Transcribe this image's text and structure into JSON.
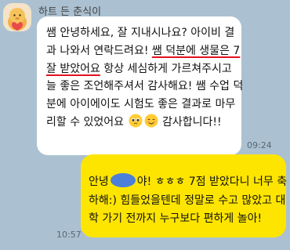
{
  "chat": {
    "sender_name": "하트 든 춘식이",
    "incoming": {
      "lines": [
        "쌤 안녕하세요, 잘 지내시나요? 아이비 결",
        "과 나와서 연락드려요! ",
        "잘 받았어요",
        " 항상 세심하게 가르쳐주시고",
        "늘 좋은 조언해주셔서 감사해요! 쌤 수업 덕",
        "분에 아이에이도 시험도 좋은 결과로 마무",
        "리할 수 있었어요",
        " 감사합니다!!"
      ],
      "underlined_part1": "쌤 덕분에 생물은 7",
      "time": "09:24"
    },
    "outgoing": {
      "line1_prefix": "안녕",
      "line1_suffix": "야! ㅎㅎㅎ 7점 받았다니 너무 축",
      "line2": "하해:) 힘들었을텐데 정말로 수고 많았고 대",
      "line3": "학 가기 전까지 누구보다 편하게 놀아!",
      "time": "10:57"
    }
  },
  "colors": {
    "background": "#ABC1D1",
    "incoming_bubble": "#FFFFFF",
    "outgoing_bubble": "#FEE500",
    "underline": "#E4111F",
    "redacted_blob": "#4C7FD9"
  }
}
